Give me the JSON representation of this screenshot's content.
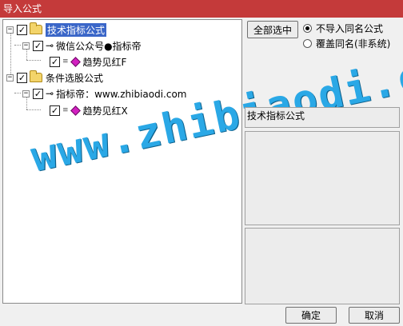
{
  "window": {
    "title": "导入公式"
  },
  "tree": {
    "nodes": [
      {
        "label": "技术指标公式"
      },
      {
        "label": "微信公众号●指标帝"
      },
      {
        "label": "趋势见红F"
      },
      {
        "label": "条件选股公式"
      },
      {
        "label": "指标帝：www.zhibiaodi.com"
      },
      {
        "label": "趋势见红X"
      }
    ],
    "check": "✓",
    "minus": "−"
  },
  "options": {
    "select_all_label": "全部选中",
    "radio_skip_label": "不导入同名公式",
    "radio_overwrite_label": "覆盖同名(非系统)"
  },
  "info": {
    "title": "技术指标公式"
  },
  "watermark": "www.zhibiaodi.com",
  "footer": {
    "ok_label": "确定",
    "cancel_label": "取消"
  },
  "icons": {
    "key": "⊸",
    "eq": "≡"
  }
}
